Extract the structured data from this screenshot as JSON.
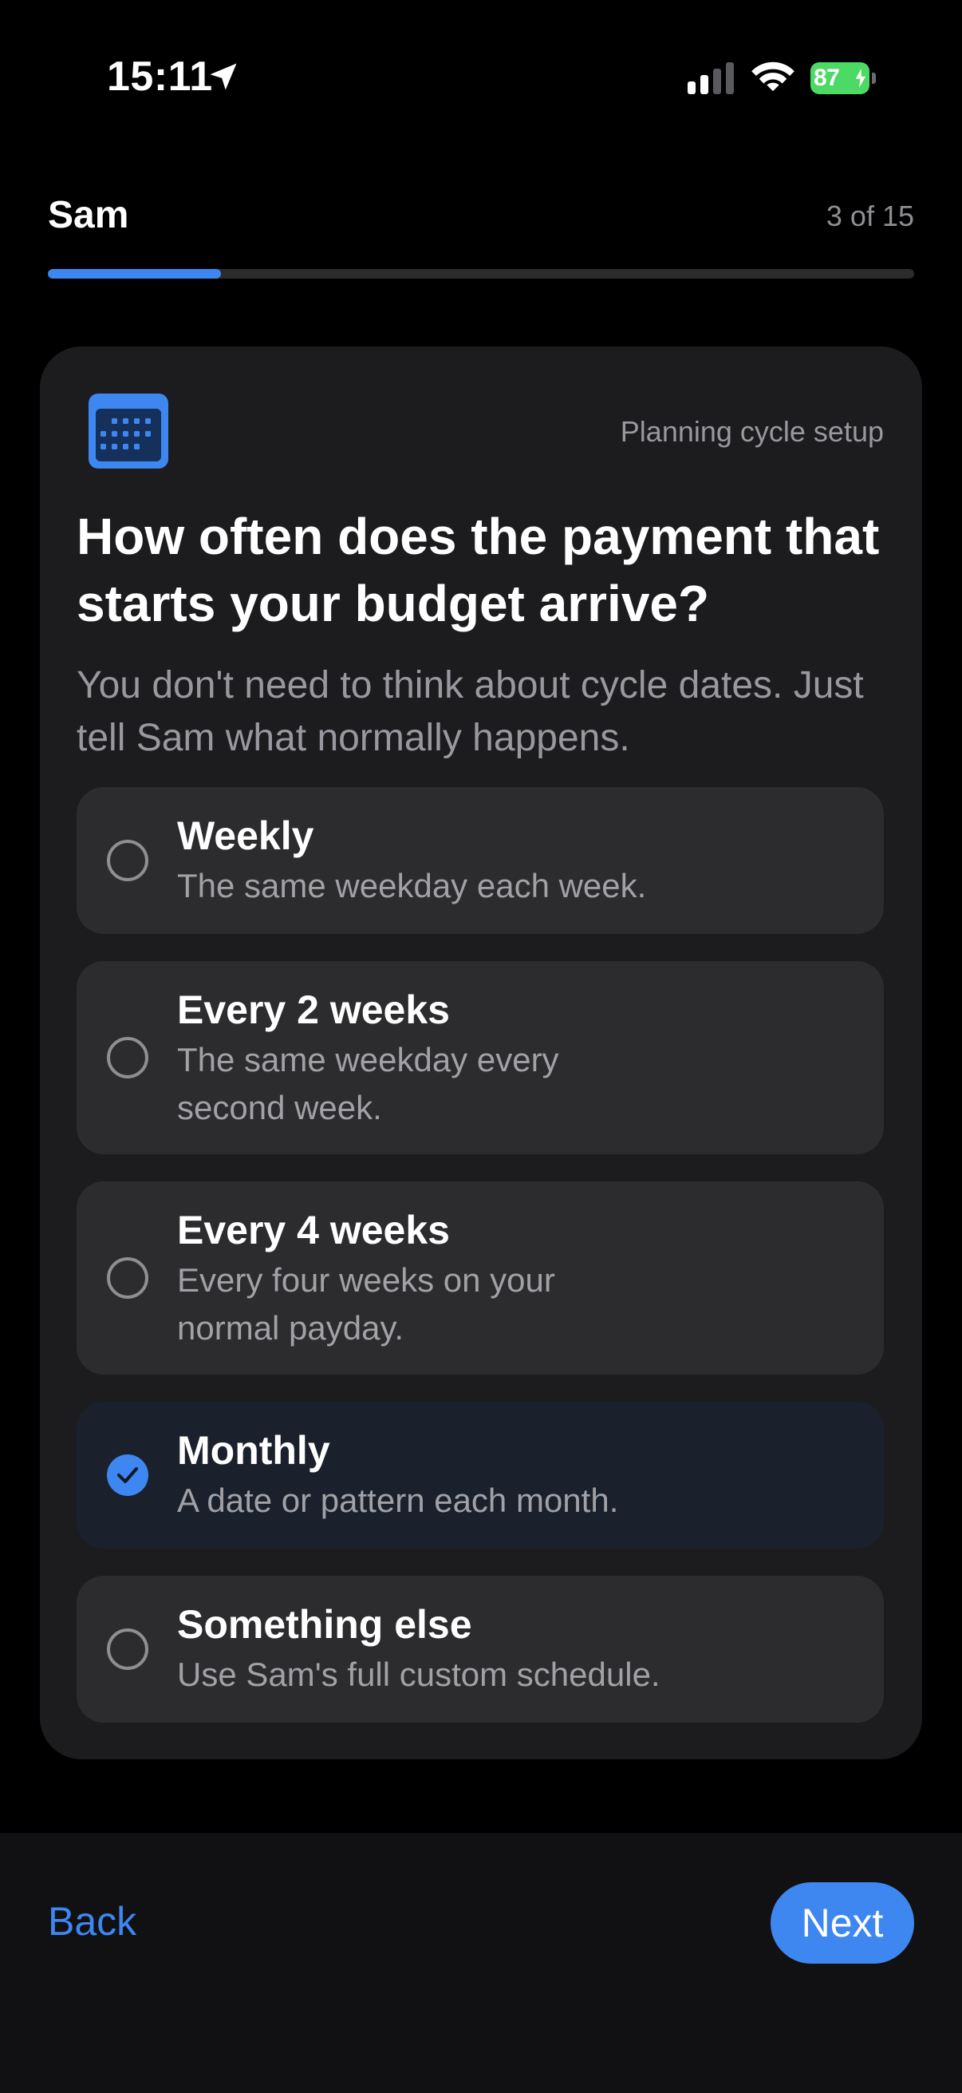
{
  "status_bar": {
    "time": "15:11",
    "battery_level": "87",
    "battery_color": "#4cd964"
  },
  "header": {
    "app_name": "Sam",
    "step": "3 of 15",
    "progress_fraction": 0.2
  },
  "card": {
    "icon": "calendar-icon",
    "tag": "Planning cycle setup",
    "question": "How often does the payment that starts your budget arrive?",
    "subtitle": "You don't need to think about cycle dates. Just tell Sam what normally happens.",
    "options": [
      {
        "title": "Weekly",
        "description": "The same weekday each week.",
        "selected": false
      },
      {
        "title": "Every 2 weeks",
        "description": "The same weekday every second week.",
        "selected": false
      },
      {
        "title": "Every 4 weeks",
        "description": "Every four weeks on your normal payday.",
        "selected": false
      },
      {
        "title": "Monthly",
        "description": "A date or pattern each month.",
        "selected": true
      },
      {
        "title": "Something else",
        "description": "Use Sam's full custom schedule.",
        "selected": false
      }
    ]
  },
  "footer": {
    "back_label": "Back",
    "next_label": "Next"
  },
  "colors": {
    "accent": "#3e86f0",
    "background": "#000000",
    "card": "#1c1c1e",
    "option": "#2c2c2e",
    "option_selected": "#1a212d"
  }
}
